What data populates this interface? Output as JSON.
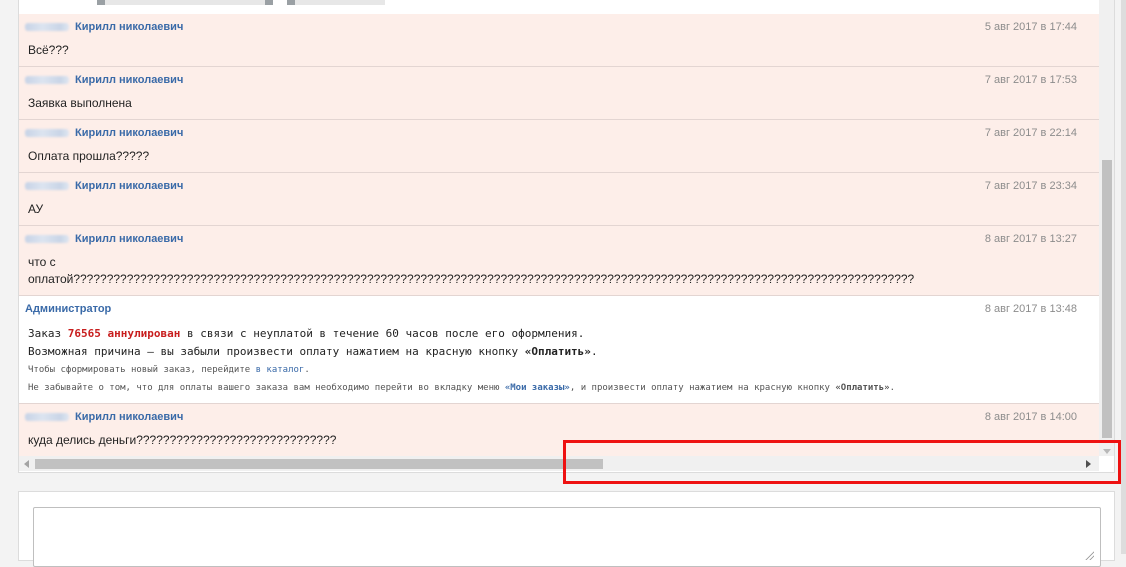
{
  "messages": [
    {
      "author": "Кирилл николаевич",
      "date": "5 авг 2017 в 17:44",
      "text": "Всё???"
    },
    {
      "author": "Кирилл николаевич",
      "date": "7 авг 2017 в 17:53",
      "text": "Заявка выполнена"
    },
    {
      "author": "Кирилл николаевич",
      "date": "7 авг 2017 в 22:14",
      "text": "Оплата прошла?????"
    },
    {
      "author": "Кирилл николаевич",
      "date": "7 авг 2017 в 23:34",
      "text": "АУ"
    },
    {
      "author": "Кирилл николаевич",
      "date": "8 авг 2017 в 13:27",
      "text_line1": "что с",
      "text_line2": "оплатой??????????????????????????????????????????????????????????????????????????????????????????????????????????????????????????????"
    },
    {
      "author": "Кирилл николаевич",
      "date": "8 авг 2017 в 14:00",
      "text": "куда делись деньги??????????????????????????????"
    }
  ],
  "admin_message": {
    "author": "Администратор",
    "date": "8 авг 2017 в 13:48",
    "line1_prefix": "Заказ ",
    "order_number": "76565",
    "status": "аннулирован",
    "line1_suffix": " в связи с неуплатой в течение 60 часов после его оформления.",
    "line2_prefix": "Возможная причина — вы забыли произвести оплату нажатием на красную кнопку ",
    "line2_button": "«Оплатить»",
    "line2_suffix": ".",
    "line3_prefix": "Чтобы сформировать новый заказ, перейдите ",
    "line3_link": "в каталог",
    "line3_suffix": ".",
    "line4_prefix": "Не забывайте о том, что для оплаты вашего заказа вам необходимо перейти во вкладку меню ",
    "line4_link": "«Мои заказы»",
    "line4_middle": ", и произвести оплату нажатием на красную кнопку ",
    "line4_button": "«Оплатить»",
    "line4_suffix": "."
  },
  "reply": {
    "value": ""
  },
  "colors": {
    "user_message_bg": "#fdeee9",
    "author_link": "#3a6aa8",
    "order_red": "#c81e1e",
    "highlight_border": "#ee1111"
  },
  "icons": [
    "scroll-left-arrow-icon",
    "scroll-right-arrow-icon",
    "scroll-down-arrow-icon",
    "resize-grip-icon"
  ]
}
